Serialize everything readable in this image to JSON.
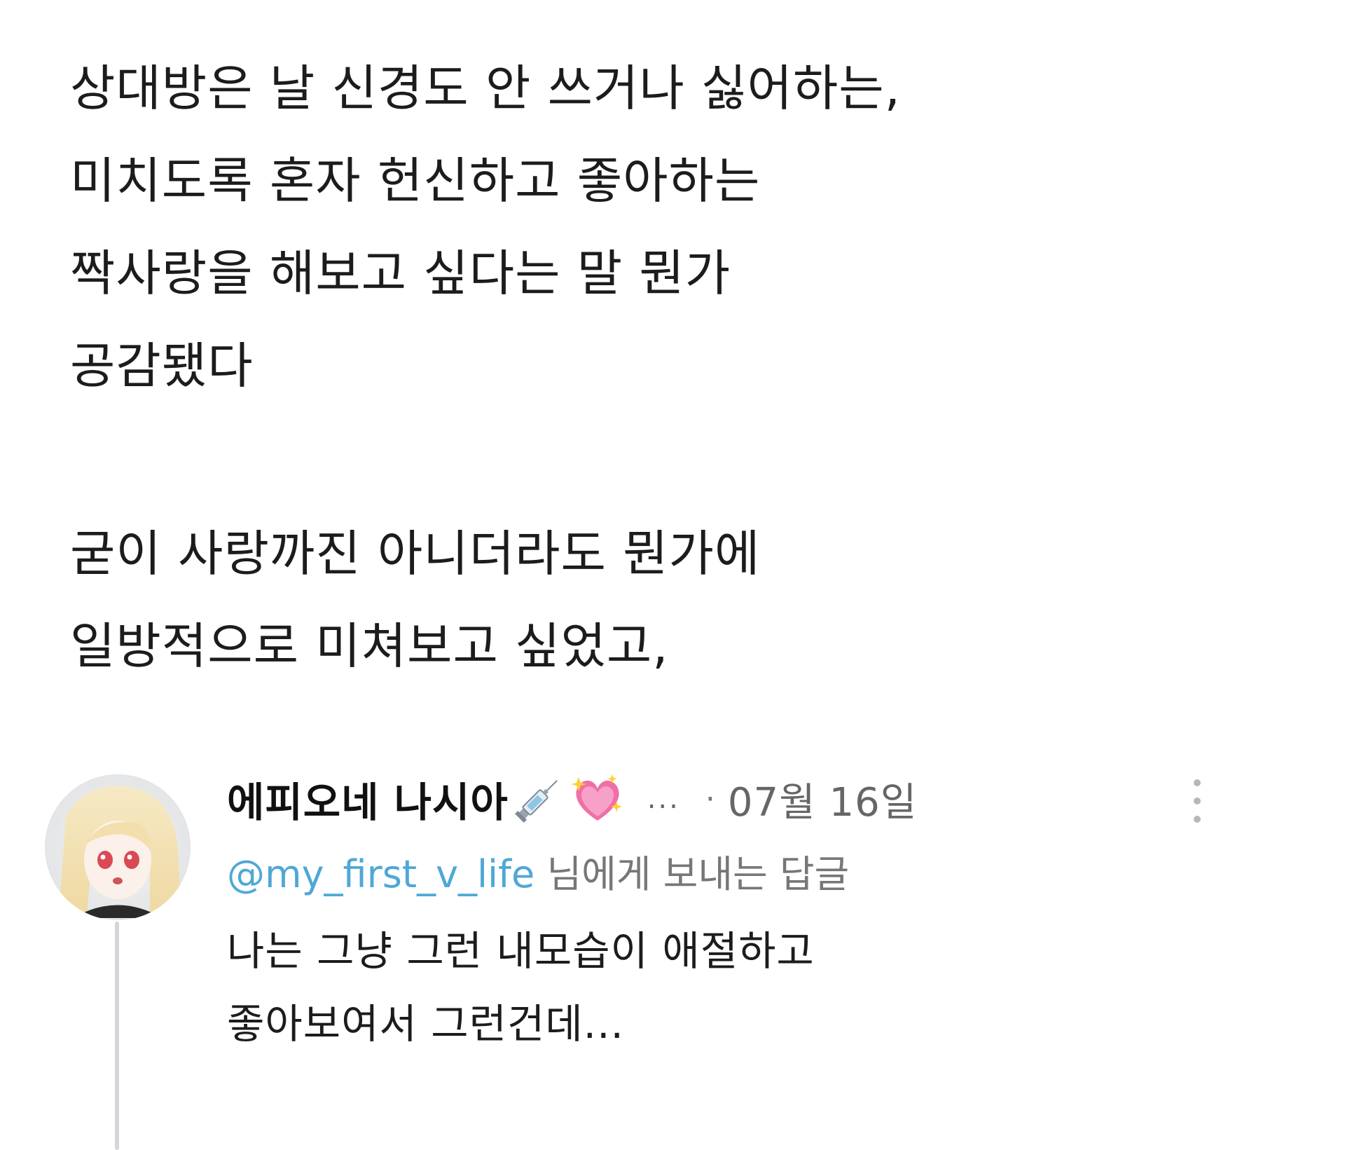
{
  "post": {
    "paragraph1": [
      "상대방은 날 신경도 안 쓰거나 싫어하는,",
      "미치도록 혼자 헌신하고 좋아하는",
      "짝사랑을 해보고 싶다는 말 뭔가",
      "공감됐다"
    ],
    "paragraph2": [
      "굳이 사랑까진 아니더라도 뭔가에",
      "일방적으로 미쳐보고 싶었고,"
    ]
  },
  "reply": {
    "display_name": "에피오네 나시아",
    "name_emojis": [
      "syringe-icon",
      "sparkling-heart-icon"
    ],
    "ellipsis": "...",
    "separator": "·",
    "date": "07월 16일",
    "reply_to_handle": "@my_first_v_life",
    "reply_to_suffix": " 님에게 보내는 답글",
    "text": [
      "나는 그냥 그런 내모습이 애절하고",
      "좋아보여서 그런건데..."
    ],
    "colors": {
      "mention": "#4fa8d6",
      "meta": "#666666",
      "thread_line": "#d3d6da"
    }
  }
}
